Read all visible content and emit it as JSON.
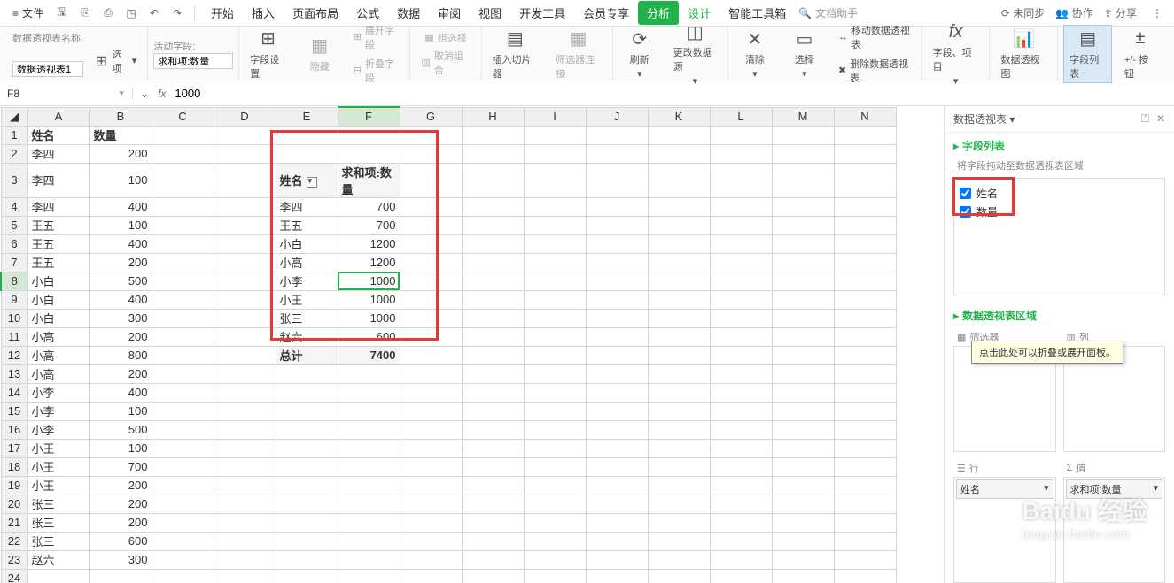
{
  "menubar": {
    "file": "文件",
    "tabs": [
      "开始",
      "插入",
      "页面布局",
      "公式",
      "数据",
      "审阅",
      "视图",
      "开发工具",
      "会员专享",
      "分析",
      "设计",
      "智能工具箱"
    ],
    "active_tab": "分析",
    "search_placeholder": "文档助手",
    "right": {
      "sync": "未同步",
      "collab": "协作",
      "share": "分享"
    }
  },
  "ribbon": {
    "pivot_name_label": "数据透视表名称:",
    "pivot_name_value": "数据透视表1",
    "options": "选项",
    "active_field_label": "活动字段:",
    "active_field_value": "求和项:数量",
    "field_settings": "字段设置",
    "hide": "隐藏",
    "expand_field": "展开字段",
    "collapse_field": "折叠字段",
    "group_select": "组选择",
    "ungroup": "取消组合",
    "insert_slicer": "插入切片器",
    "filter_conn": "筛选器连接",
    "refresh": "刷新",
    "change_source": "更改数据源",
    "clear": "清除",
    "select": "选择",
    "move_pivot": "移动数据透视表",
    "delete_pivot": "删除数据透视表",
    "fields_items": "字段、项目",
    "pivot_chart": "数据透视图",
    "field_list": "字段列表",
    "buttons": "+/- 按钮"
  },
  "formula": {
    "cell": "F8",
    "value": "1000"
  },
  "columns": [
    "A",
    "B",
    "C",
    "D",
    "E",
    "F",
    "G",
    "H",
    "I",
    "J",
    "K",
    "L",
    "M",
    "N"
  ],
  "raw_header": {
    "name": "姓名",
    "qty": "数量"
  },
  "raw_data": [
    [
      "李四",
      200
    ],
    [
      "李四",
      100
    ],
    [
      "李四",
      400
    ],
    [
      "王五",
      100
    ],
    [
      "王五",
      400
    ],
    [
      "王五",
      200
    ],
    [
      "小白",
      500
    ],
    [
      "小白",
      400
    ],
    [
      "小白",
      300
    ],
    [
      "小高",
      200
    ],
    [
      "小高",
      800
    ],
    [
      "小高",
      200
    ],
    [
      "小李",
      400
    ],
    [
      "小李",
      100
    ],
    [
      "小李",
      500
    ],
    [
      "小王",
      100
    ],
    [
      "小王",
      700
    ],
    [
      "小王",
      200
    ],
    [
      "张三",
      200
    ],
    [
      "张三",
      200
    ],
    [
      "张三",
      600
    ],
    [
      "赵六",
      300
    ]
  ],
  "pivot": {
    "hdr_name": "姓名",
    "hdr_sum": "求和项:数量",
    "rows": [
      [
        "李四",
        700
      ],
      [
        "王五",
        700
      ],
      [
        "小白",
        1200
      ],
      [
        "小高",
        1200
      ],
      [
        "小李",
        1000
      ],
      [
        "小王",
        1000
      ],
      [
        "张三",
        1000
      ],
      [
        "赵六",
        600
      ]
    ],
    "total_label": "总计",
    "total_value": 7400,
    "selected_row_index": 4
  },
  "panel": {
    "title": "数据透视表",
    "section_fields": "字段列表",
    "drag_hint": "将字段拖动至数据透视表区域",
    "fields": [
      "姓名",
      "数量"
    ],
    "section_areas": "数据透视表区域",
    "tooltip": "点击此处可以折叠或展开面板。",
    "area_filter": "筛选器",
    "area_col": "列",
    "area_row": "行",
    "area_val": "值",
    "row_item": "姓名",
    "val_item": "求和项:数量"
  },
  "watermark": {
    "brand": "Baidu 经验",
    "url": "jingyan.baidu.com"
  }
}
